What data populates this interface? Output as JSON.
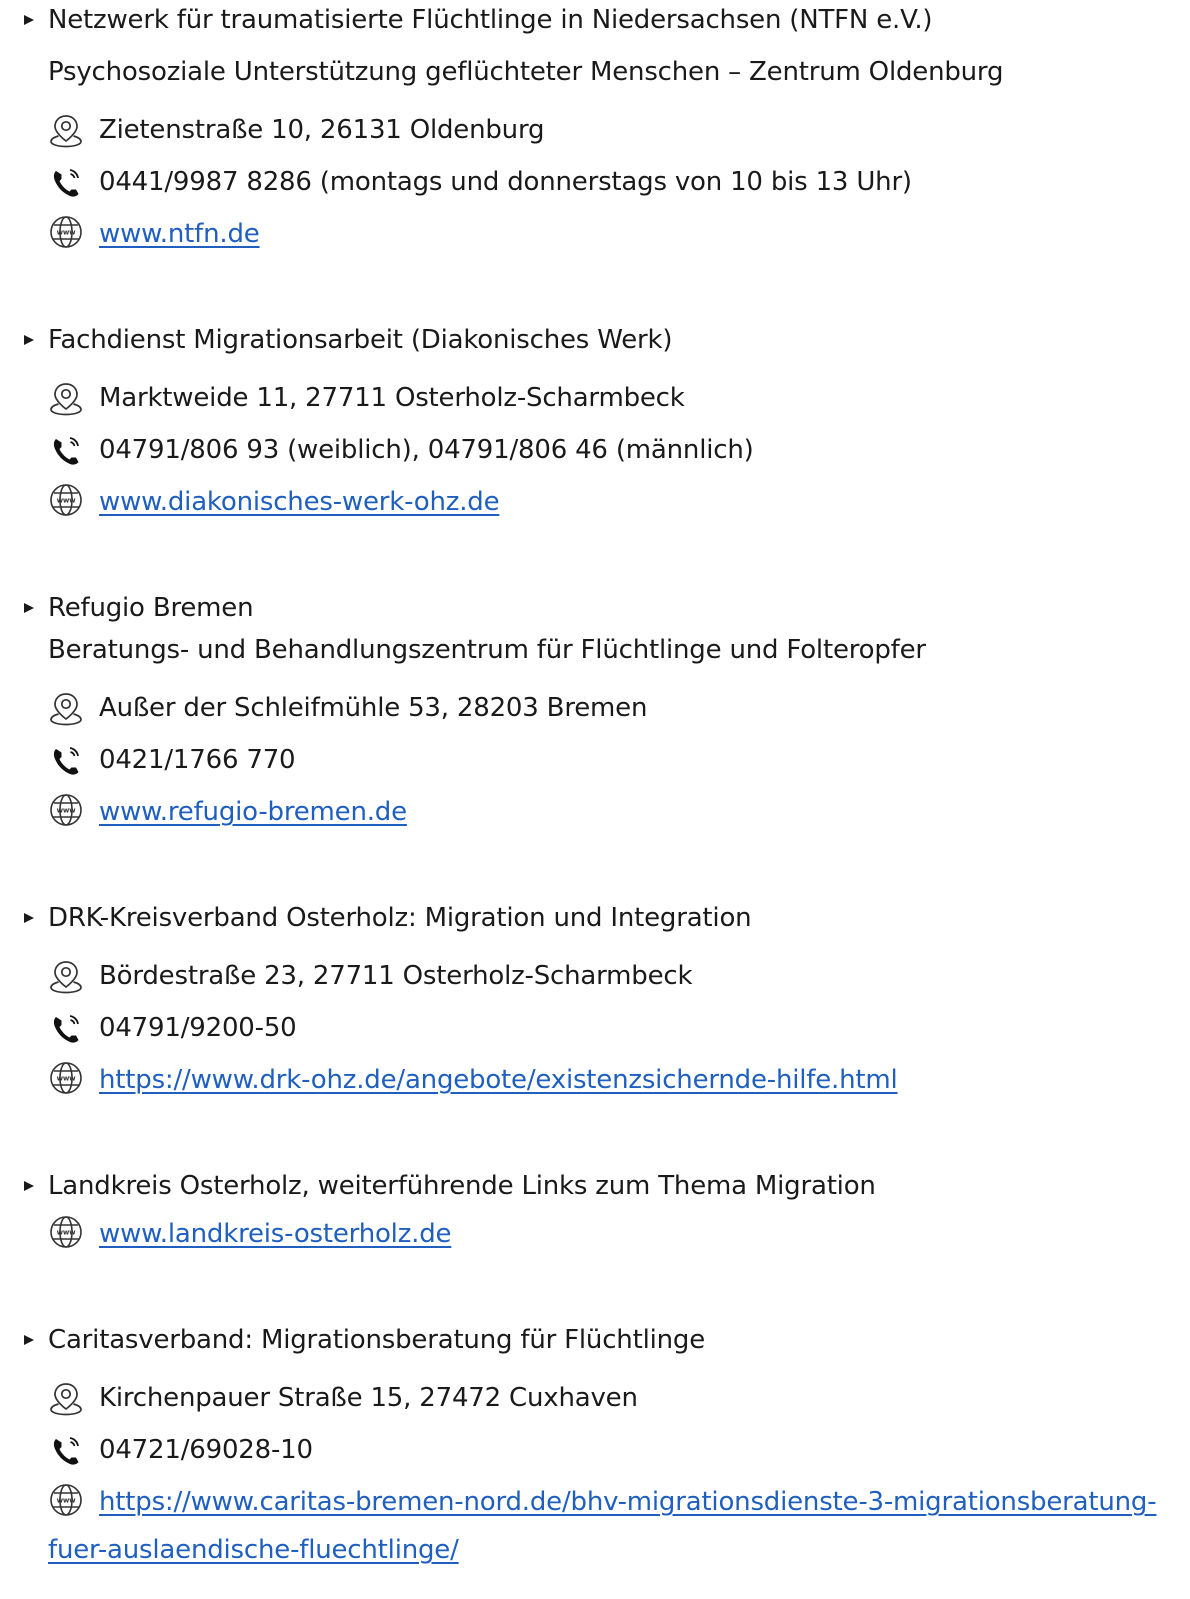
{
  "entries": [
    {
      "title": "Netzwerk für traumatisierte Flüchtlinge in Niedersachsen (NTFN e.V.)",
      "subtitle": "Psychosoziale Unterstützung geflüchteter Menschen – Zentrum Oldenburg",
      "address": "Zietenstraße 10, 26131 Oldenburg",
      "phone": "0441/9987 8286 (montags und donnerstags von 10 bis 13 Uhr)",
      "web": "www.ntfn.de"
    },
    {
      "title": "Fachdienst Migrationsarbeit (Diakonisches Werk)",
      "address": "Marktweide 11, 27711 Osterholz-Scharmbeck",
      "phone": "04791/806 93 (weiblich), 04791/806 46 (männlich)",
      "web": "www.diakonisches-werk-ohz.de"
    },
    {
      "title": "Refugio Bremen",
      "subtitle": "Beratungs- und Behandlungszentrum für Flüchtlinge und Folteropfer",
      "address": "Außer der Schleifmühle 53, 28203 Bremen",
      "phone": "0421/1766 770",
      "web": "www.refugio-bremen.de"
    },
    {
      "title": "DRK-Kreisverband Osterholz: Migration und Integration",
      "address": "Bördestraße 23, 27711 Osterholz-Scharmbeck",
      "phone": "04791/9200-50",
      "web": "https://www.drk-ohz.de/angebote/existenzsichernde-hilfe.html"
    },
    {
      "title": "Landkreis Osterholz, weiterführende Links zum Thema Migration",
      "web": "www.landkreis-osterholz.de"
    },
    {
      "title": "Caritasverband: Migrationsberatung für Flüchtlinge",
      "address": "Kirchenpauer Straße 15, 27472 Cuxhaven",
      "phone": "04721/69028-10",
      "web": "https://www.caritas-bremen-nord.de/bhv-migrationsdienste-3-migrationsberatung-",
      "web_cont": "fuer-auslaendische-fluechtlinge/"
    }
  ],
  "icons": {
    "bullet": "triangle-bullet-icon",
    "address": "location-pin-icon",
    "phone": "phone-icon",
    "web": "www-globe-icon"
  },
  "colors": {
    "text": "#1a1a1a",
    "link": "#1f5fbf"
  }
}
